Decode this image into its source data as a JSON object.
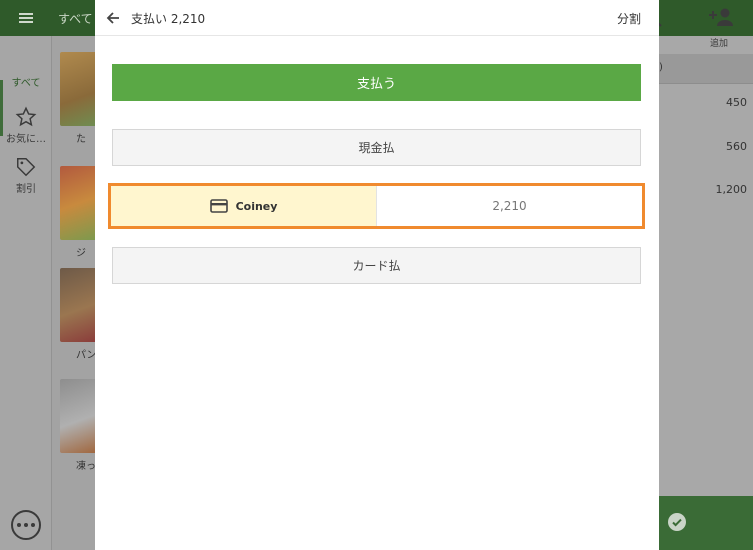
{
  "background": {
    "category_label": "すべて",
    "sidebar": [
      {
        "label": "すべて",
        "icon": "grid-icon"
      },
      {
        "label": "お気に…",
        "icon": "star-icon"
      },
      {
        "label": "割引",
        "icon": "tag-icon"
      }
    ],
    "products": [
      {
        "name": "た"
      },
      {
        "name": "ジ"
      },
      {
        "name": "パン"
      },
      {
        "name": "凍った"
      }
    ],
    "order_header_fragment": ")",
    "order_prices": [
      "450",
      "560",
      "1,200"
    ],
    "add_label": "追加",
    "search_label_fragment": "索"
  },
  "dialog": {
    "title": "支払い 2,210",
    "split_label": "分割",
    "pay_label": "支払う",
    "cash_label": "現金払",
    "coiney": {
      "label": "Coiney",
      "icon": "credit-card-icon",
      "amount": "2,210"
    },
    "card_label": "カード払"
  },
  "colors": {
    "accent_green": "#5aa845",
    "highlight_orange": "#f08a2e",
    "coiney_bg": "#fff6cf"
  }
}
